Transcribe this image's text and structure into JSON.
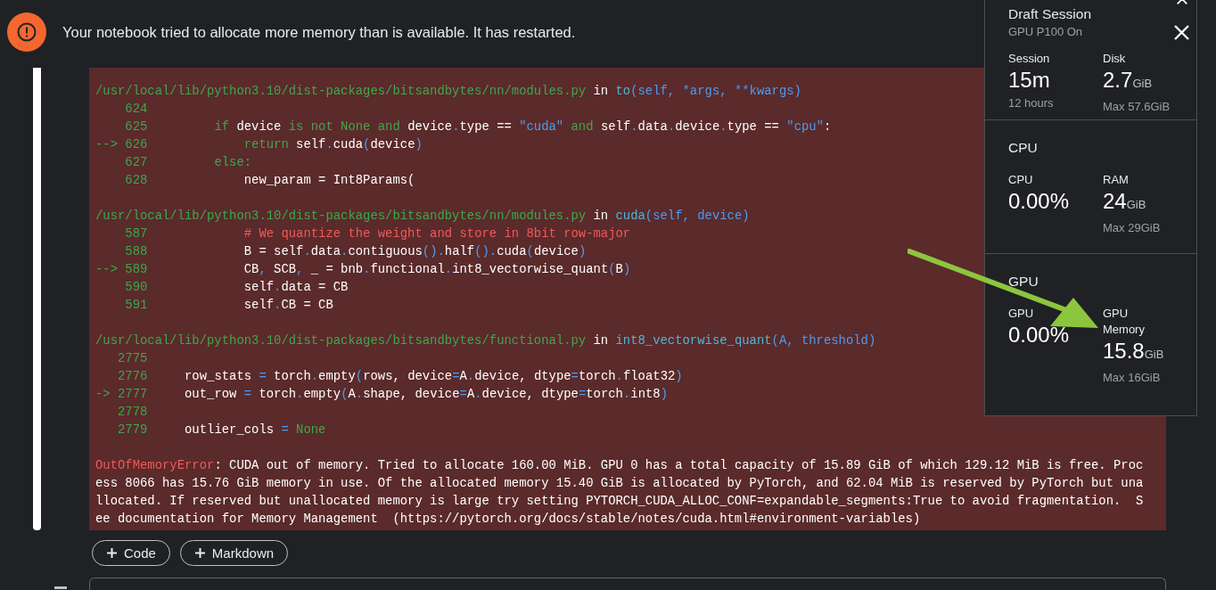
{
  "alert": {
    "message": "Your notebook tried to allocate more memory than is available. It has restarted."
  },
  "output": {
    "frames": [
      {
        "header": [
          {
            "kind": "path",
            "text": "/usr/local/lib/python3.10/dist-packages/bitsandbytes/nn/modules.py"
          },
          {
            "kind": "plain",
            "text": " in "
          },
          {
            "kind": "func",
            "text": "to"
          },
          {
            "kind": "punct",
            "text": "(self, *args, **kwargs)"
          }
        ],
        "lines": [
          {
            "gutter": "    624"
          },
          {
            "gutter": "    625",
            "code": [
              {
                "kind": "keyword",
                "text": "         if "
              },
              {
                "kind": "plain",
                "text": "device "
              },
              {
                "kind": "keyword",
                "text": "is not None and "
              },
              {
                "kind": "plain",
                "text": "device"
              },
              {
                "kind": "punct",
                "text": "."
              },
              {
                "kind": "plain",
                "text": "type == "
              },
              {
                "kind": "string",
                "text": "\"cuda\""
              },
              {
                "kind": "keyword",
                "text": " and "
              },
              {
                "kind": "plain",
                "text": "self"
              },
              {
                "kind": "punct",
                "text": "."
              },
              {
                "kind": "plain",
                "text": "data"
              },
              {
                "kind": "punct",
                "text": "."
              },
              {
                "kind": "plain",
                "text": "device"
              },
              {
                "kind": "punct",
                "text": "."
              },
              {
                "kind": "plain",
                "text": "type == "
              },
              {
                "kind": "string",
                "text": "\"cpu\""
              },
              {
                "kind": "plain",
                "text": ":"
              }
            ]
          },
          {
            "gutter": "--> 626",
            "code": [
              {
                "kind": "keyword",
                "text": "             return "
              },
              {
                "kind": "plain",
                "text": "self"
              },
              {
                "kind": "punct",
                "text": "."
              },
              {
                "kind": "plain",
                "text": "cuda"
              },
              {
                "kind": "punct",
                "text": "("
              },
              {
                "kind": "plain",
                "text": "device"
              },
              {
                "kind": "punct",
                "text": ")"
              }
            ]
          },
          {
            "gutter": "    627",
            "code": [
              {
                "kind": "keyword",
                "text": "         else:"
              }
            ]
          },
          {
            "gutter": "    628",
            "code": [
              {
                "kind": "plain",
                "text": "             new_param = Int8Params("
              }
            ]
          }
        ]
      },
      {
        "header": [
          {
            "kind": "path",
            "text": "/usr/local/lib/python3.10/dist-packages/bitsandbytes/nn/modules.py"
          },
          {
            "kind": "plain",
            "text": " in "
          },
          {
            "kind": "func",
            "text": "cuda"
          },
          {
            "kind": "punct",
            "text": "(self, device)"
          }
        ],
        "lines": [
          {
            "gutter": "    587",
            "code": [
              {
                "kind": "comment",
                "text": "             # We quantize the weight and store in 8bit row-major"
              }
            ]
          },
          {
            "gutter": "    588",
            "code": [
              {
                "kind": "plain",
                "text": "             B = self"
              },
              {
                "kind": "punct",
                "text": "."
              },
              {
                "kind": "plain",
                "text": "data"
              },
              {
                "kind": "punct",
                "text": "."
              },
              {
                "kind": "plain",
                "text": "contiguous"
              },
              {
                "kind": "punct",
                "text": "()."
              },
              {
                "kind": "plain",
                "text": "half"
              },
              {
                "kind": "punct",
                "text": "()."
              },
              {
                "kind": "plain",
                "text": "cuda"
              },
              {
                "kind": "punct",
                "text": "("
              },
              {
                "kind": "plain",
                "text": "device"
              },
              {
                "kind": "punct",
                "text": ")"
              }
            ]
          },
          {
            "gutter": "--> 589",
            "code": [
              {
                "kind": "plain",
                "text": "             CB"
              },
              {
                "kind": "punct",
                "text": ","
              },
              {
                "kind": "plain",
                "text": " SCB"
              },
              {
                "kind": "punct",
                "text": ","
              },
              {
                "kind": "plain",
                "text": " _ = bnb"
              },
              {
                "kind": "punct",
                "text": "."
              },
              {
                "kind": "plain",
                "text": "functional"
              },
              {
                "kind": "punct",
                "text": "."
              },
              {
                "kind": "plain",
                "text": "int8_vectorwise_quant"
              },
              {
                "kind": "punct",
                "text": "("
              },
              {
                "kind": "plain",
                "text": "B"
              },
              {
                "kind": "punct",
                "text": ")"
              }
            ]
          },
          {
            "gutter": "    590",
            "code": [
              {
                "kind": "plain",
                "text": "             self"
              },
              {
                "kind": "punct",
                "text": "."
              },
              {
                "kind": "plain",
                "text": "data = CB"
              }
            ]
          },
          {
            "gutter": "    591",
            "code": [
              {
                "kind": "plain",
                "text": "             self"
              },
              {
                "kind": "punct",
                "text": "."
              },
              {
                "kind": "plain",
                "text": "CB = CB"
              }
            ]
          }
        ]
      },
      {
        "header": [
          {
            "kind": "path",
            "text": "/usr/local/lib/python3.10/dist-packages/bitsandbytes/functional.py"
          },
          {
            "kind": "plain",
            "text": " in "
          },
          {
            "kind": "func",
            "text": "int8_vectorwise_quant"
          },
          {
            "kind": "punct",
            "text": "(A, threshold)"
          }
        ],
        "lines": [
          {
            "gutter": "   2775"
          },
          {
            "gutter": "   2776",
            "code": [
              {
                "kind": "plain",
                "text": "     row_stats "
              },
              {
                "kind": "punct",
                "text": "="
              },
              {
                "kind": "plain",
                "text": " torch"
              },
              {
                "kind": "punct",
                "text": "."
              },
              {
                "kind": "plain",
                "text": "empty"
              },
              {
                "kind": "punct",
                "text": "("
              },
              {
                "kind": "plain",
                "text": "rows, device"
              },
              {
                "kind": "punct",
                "text": "="
              },
              {
                "kind": "plain",
                "text": "A"
              },
              {
                "kind": "punct",
                "text": "."
              },
              {
                "kind": "plain",
                "text": "device, dtype"
              },
              {
                "kind": "punct",
                "text": "="
              },
              {
                "kind": "plain",
                "text": "torch"
              },
              {
                "kind": "punct",
                "text": "."
              },
              {
                "kind": "plain",
                "text": "float32"
              },
              {
                "kind": "punct",
                "text": ")"
              }
            ]
          },
          {
            "gutter": "-> 2777",
            "code": [
              {
                "kind": "plain",
                "text": "     out_row "
              },
              {
                "kind": "punct",
                "text": "="
              },
              {
                "kind": "plain",
                "text": " torch"
              },
              {
                "kind": "punct",
                "text": "."
              },
              {
                "kind": "plain",
                "text": "empty"
              },
              {
                "kind": "punct",
                "text": "("
              },
              {
                "kind": "plain",
                "text": "A"
              },
              {
                "kind": "punct",
                "text": "."
              },
              {
                "kind": "plain",
                "text": "shape, device"
              },
              {
                "kind": "punct",
                "text": "="
              },
              {
                "kind": "plain",
                "text": "A"
              },
              {
                "kind": "punct",
                "text": "."
              },
              {
                "kind": "plain",
                "text": "device, dtype"
              },
              {
                "kind": "punct",
                "text": "="
              },
              {
                "kind": "plain",
                "text": "torch"
              },
              {
                "kind": "punct",
                "text": "."
              },
              {
                "kind": "plain",
                "text": "int8"
              },
              {
                "kind": "punct",
                "text": ")"
              }
            ]
          },
          {
            "gutter": "   2778"
          },
          {
            "gutter": "   2779",
            "code": [
              {
                "kind": "plain",
                "text": "     outlier_cols "
              },
              {
                "kind": "punct",
                "text": "="
              },
              {
                "kind": "keyword",
                "text": " None"
              }
            ]
          }
        ]
      }
    ],
    "error": {
      "name": "OutOfMemoryError",
      "lines": [
        ": CUDA out of memory. Tried to allocate 160.00 MiB. GPU 0 has a total capacity of 15.89 GiB of which 129.12 MiB is free. Proc",
        "ess 8066 has 15.76 GiB memory in use. Of the allocated memory 15.40 GiB is allocated by PyTorch, and 62.04 MiB is reserved by PyTorch but una",
        "llocated. If reserved but unallocated memory is large try setting PYTORCH_CUDA_ALLOC_CONF=expandable_segments:True to avoid fragmentation.  S",
        "ee documentation for Memory Management  (https://pytorch.org/docs/stable/notes/cuda.html#environment-variables)"
      ]
    }
  },
  "add_buttons": [
    "Code",
    "Markdown"
  ],
  "panel": {
    "title": "Draft Session",
    "subtitle": "GPU P100 On",
    "sections": [
      {
        "stats": [
          {
            "label": "Session",
            "value": "15m",
            "sub": "12 hours"
          },
          {
            "label": "Disk",
            "value": "2.7",
            "unit": "GiB",
            "sub": "Max 57.6GiB"
          }
        ]
      },
      {
        "heading": "CPU",
        "stats": [
          {
            "label": "CPU",
            "value": "0.00%"
          },
          {
            "label": "RAM",
            "value": "24",
            "unit": "GiB",
            "sub": "Max 29GiB"
          }
        ]
      },
      {
        "heading": "GPU",
        "stats": [
          {
            "label": "GPU",
            "value": "0.00%"
          },
          {
            "label": "GPU Memory",
            "value": "15.8",
            "unit": "GiB",
            "sub": "Max 16GiB"
          }
        ]
      }
    ]
  }
}
